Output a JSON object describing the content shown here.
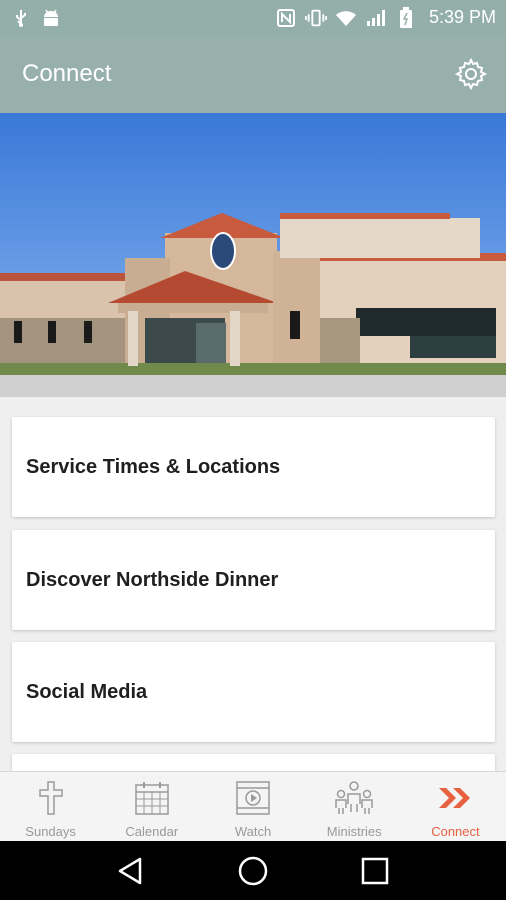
{
  "status_bar": {
    "time": "5:39 PM",
    "icons": [
      "usb-icon",
      "android-icon",
      "nfc-icon",
      "vibrate-icon",
      "wifi-icon",
      "signal-icon",
      "battery-icon"
    ]
  },
  "app_bar": {
    "title": "Connect",
    "settings_icon": "gear-icon"
  },
  "hero": {
    "image": "church-building-photo"
  },
  "cards": [
    {
      "label": "Service Times & Locations"
    },
    {
      "label": "Discover Northside Dinner"
    },
    {
      "label": "Social Media"
    }
  ],
  "bottom_nav": {
    "items": [
      {
        "label": "Sundays",
        "icon": "cross-icon",
        "active": false
      },
      {
        "label": "Calendar",
        "icon": "calendar-icon",
        "active": false
      },
      {
        "label": "Watch",
        "icon": "video-icon",
        "active": false
      },
      {
        "label": "Ministries",
        "icon": "people-icon",
        "active": false
      },
      {
        "label": "Connect",
        "icon": "chevrons-icon",
        "active": true
      }
    ]
  },
  "colors": {
    "app_bar": "#98b0ac",
    "accent": "#e7603f",
    "inactive_nav": "#999999"
  },
  "system_nav": [
    "back-icon",
    "home-icon",
    "recents-icon"
  ]
}
